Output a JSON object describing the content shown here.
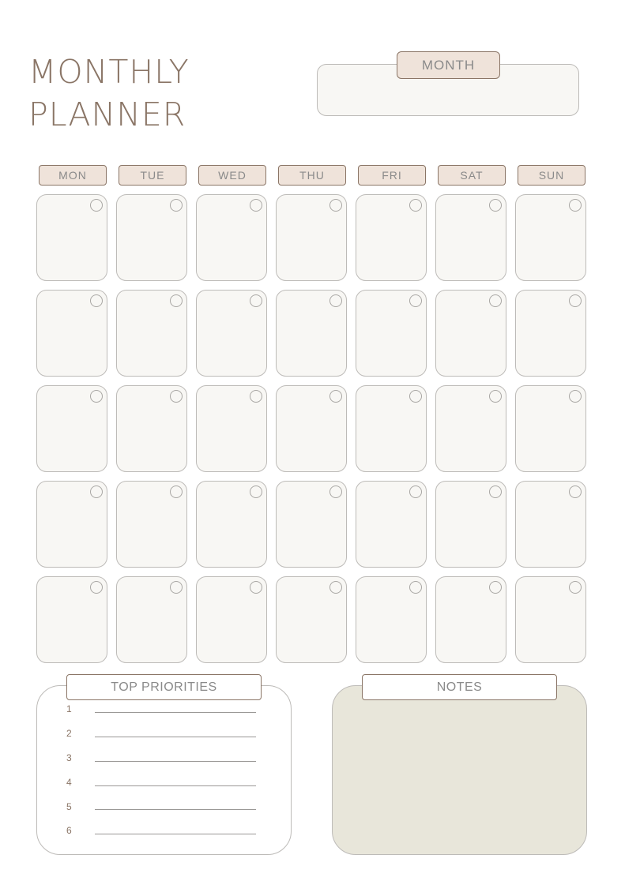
{
  "title": {
    "line1": "MONTHLY",
    "line2": "PLANNER"
  },
  "month": {
    "label": "MONTH",
    "value": ""
  },
  "weekdays": [
    "MON",
    "TUE",
    "WED",
    "THU",
    "FRI",
    "SAT",
    "SUN"
  ],
  "priorities": {
    "heading": "TOP PRIORITIES",
    "items": [
      {
        "number": "1",
        "text": ""
      },
      {
        "number": "2",
        "text": ""
      },
      {
        "number": "3",
        "text": ""
      },
      {
        "number": "4",
        "text": ""
      },
      {
        "number": "5",
        "text": ""
      },
      {
        "number": "6",
        "text": ""
      }
    ]
  },
  "notes": {
    "heading": "NOTES",
    "text": ""
  },
  "colors": {
    "accent_brown": "#8a7566",
    "tab_fill": "#efe3da",
    "cell_fill": "#f8f7f4",
    "notes_fill": "#e8e6da",
    "border_gray": "#bdbbb8"
  }
}
